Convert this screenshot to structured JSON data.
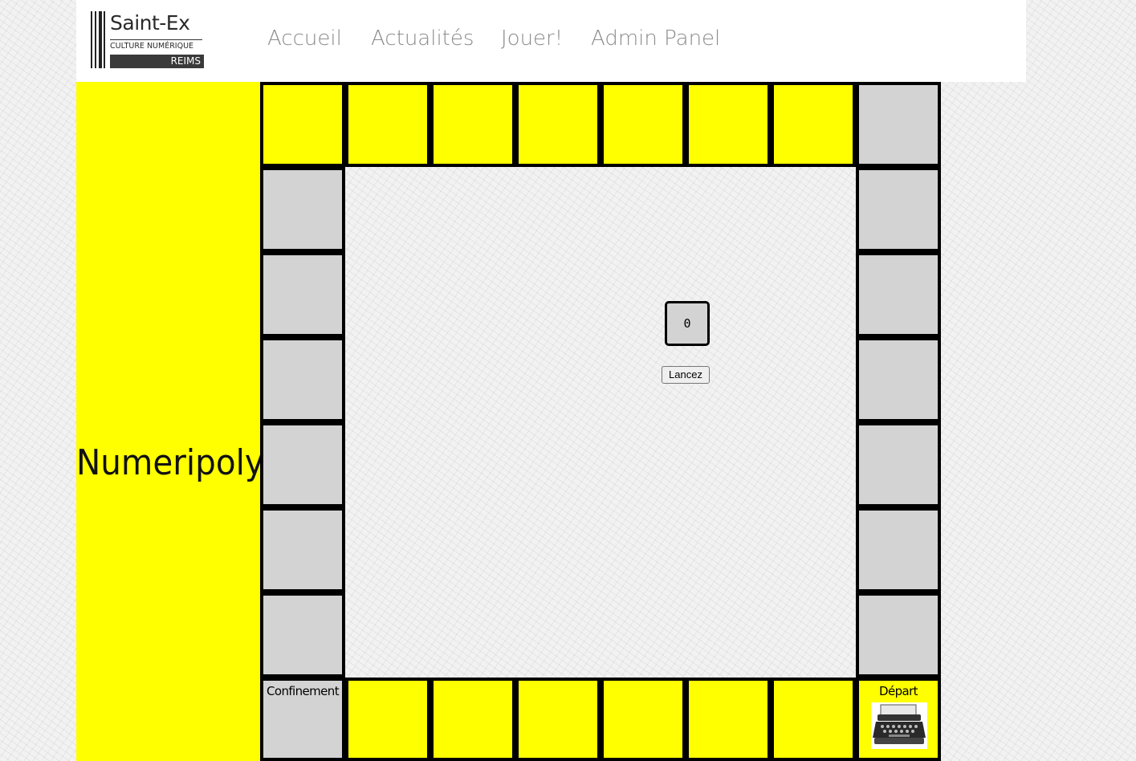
{
  "logo": {
    "name": "Saint-Ex",
    "subtitle": "CULTURE NUMÉRIQUE",
    "city": "REIMS"
  },
  "nav": {
    "items": [
      {
        "label": "Accueil"
      },
      {
        "label": "Actualités"
      },
      {
        "label": "Jouer!"
      },
      {
        "label": "Admin Panel"
      }
    ]
  },
  "game": {
    "title": "Numeripoly",
    "dice_value": "0",
    "roll_button": "Lancez",
    "corner_start_label": "Départ",
    "corner_jail_label": "Confinement"
  },
  "colors": {
    "accent": "#ffff00",
    "cell_gray": "#d3d3d3",
    "border": "#000000",
    "nav_text": "#8c8c8c"
  },
  "icons": {
    "start": "typewriter-icon"
  }
}
